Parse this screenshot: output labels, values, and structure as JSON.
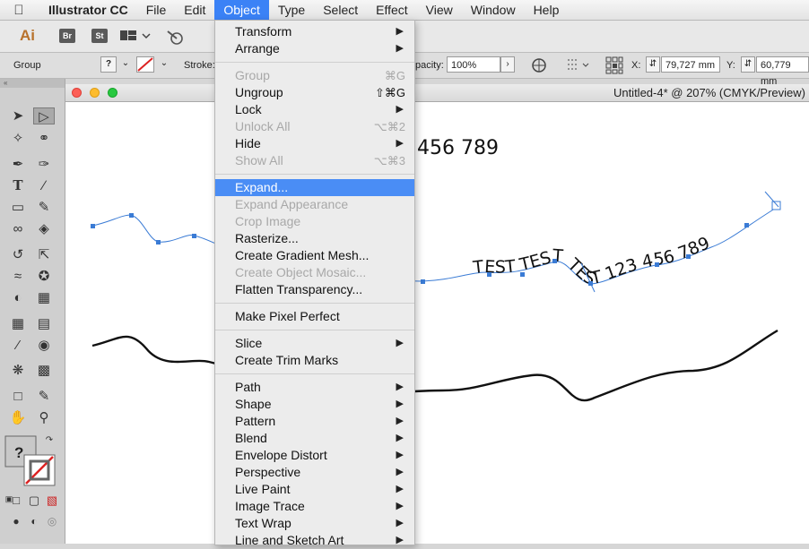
{
  "menubar": {
    "app": "Illustrator CC",
    "items": [
      "File",
      "Edit",
      "Object",
      "Type",
      "Select",
      "Effect",
      "View",
      "Window",
      "Help"
    ]
  },
  "appbar": {
    "logo": "Ai",
    "bridge": "Br",
    "stock": "St"
  },
  "control": {
    "selection": "Group",
    "fill_value": "?",
    "stroke_label": "Stroke:",
    "opacity_label": "pacity:",
    "opacity_value": "100%",
    "x_label": "X:",
    "x_value": "79,727 mm",
    "y_label": "Y:",
    "y_value": "60,779 mm"
  },
  "document": {
    "title": "Untitled-4* @ 207% (CMYK/Preview)"
  },
  "canvas": {
    "top_text": "456 789",
    "path_text": "TEST TEST TEST 123 456 789"
  },
  "object_menu": {
    "groups": [
      [
        {
          "label": "Transform",
          "submenu": true
        },
        {
          "label": "Arrange",
          "submenu": true
        }
      ],
      [
        {
          "label": "Group",
          "shortcut": "⌘G",
          "disabled": true
        },
        {
          "label": "Ungroup",
          "shortcut": "⇧⌘G"
        },
        {
          "label": "Lock",
          "submenu": true
        },
        {
          "label": "Unlock All",
          "shortcut": "⌥⌘2",
          "disabled": true
        },
        {
          "label": "Hide",
          "submenu": true
        },
        {
          "label": "Show All",
          "shortcut": "⌥⌘3",
          "disabled": true
        }
      ],
      [
        {
          "label": "Expand...",
          "highlighted": true
        },
        {
          "label": "Expand Appearance",
          "disabled": true
        },
        {
          "label": "Crop Image",
          "disabled": true
        },
        {
          "label": "Rasterize..."
        },
        {
          "label": "Create Gradient Mesh..."
        },
        {
          "label": "Create Object Mosaic...",
          "disabled": true
        },
        {
          "label": "Flatten Transparency..."
        }
      ],
      [
        {
          "label": "Make Pixel Perfect"
        }
      ],
      [
        {
          "label": "Slice",
          "submenu": true
        },
        {
          "label": "Create Trim Marks"
        }
      ],
      [
        {
          "label": "Path",
          "submenu": true
        },
        {
          "label": "Shape",
          "submenu": true
        },
        {
          "label": "Pattern",
          "submenu": true
        },
        {
          "label": "Blend",
          "submenu": true
        },
        {
          "label": "Envelope Distort",
          "submenu": true
        },
        {
          "label": "Perspective",
          "submenu": true
        },
        {
          "label": "Live Paint",
          "submenu": true
        },
        {
          "label": "Image Trace",
          "submenu": true
        },
        {
          "label": "Text Wrap",
          "submenu": true
        },
        {
          "label": "Line and Sketch Art",
          "submenu": true
        }
      ]
    ]
  },
  "colors": {
    "accent": "#4a8df5",
    "path_blue": "#3a7bd5"
  }
}
